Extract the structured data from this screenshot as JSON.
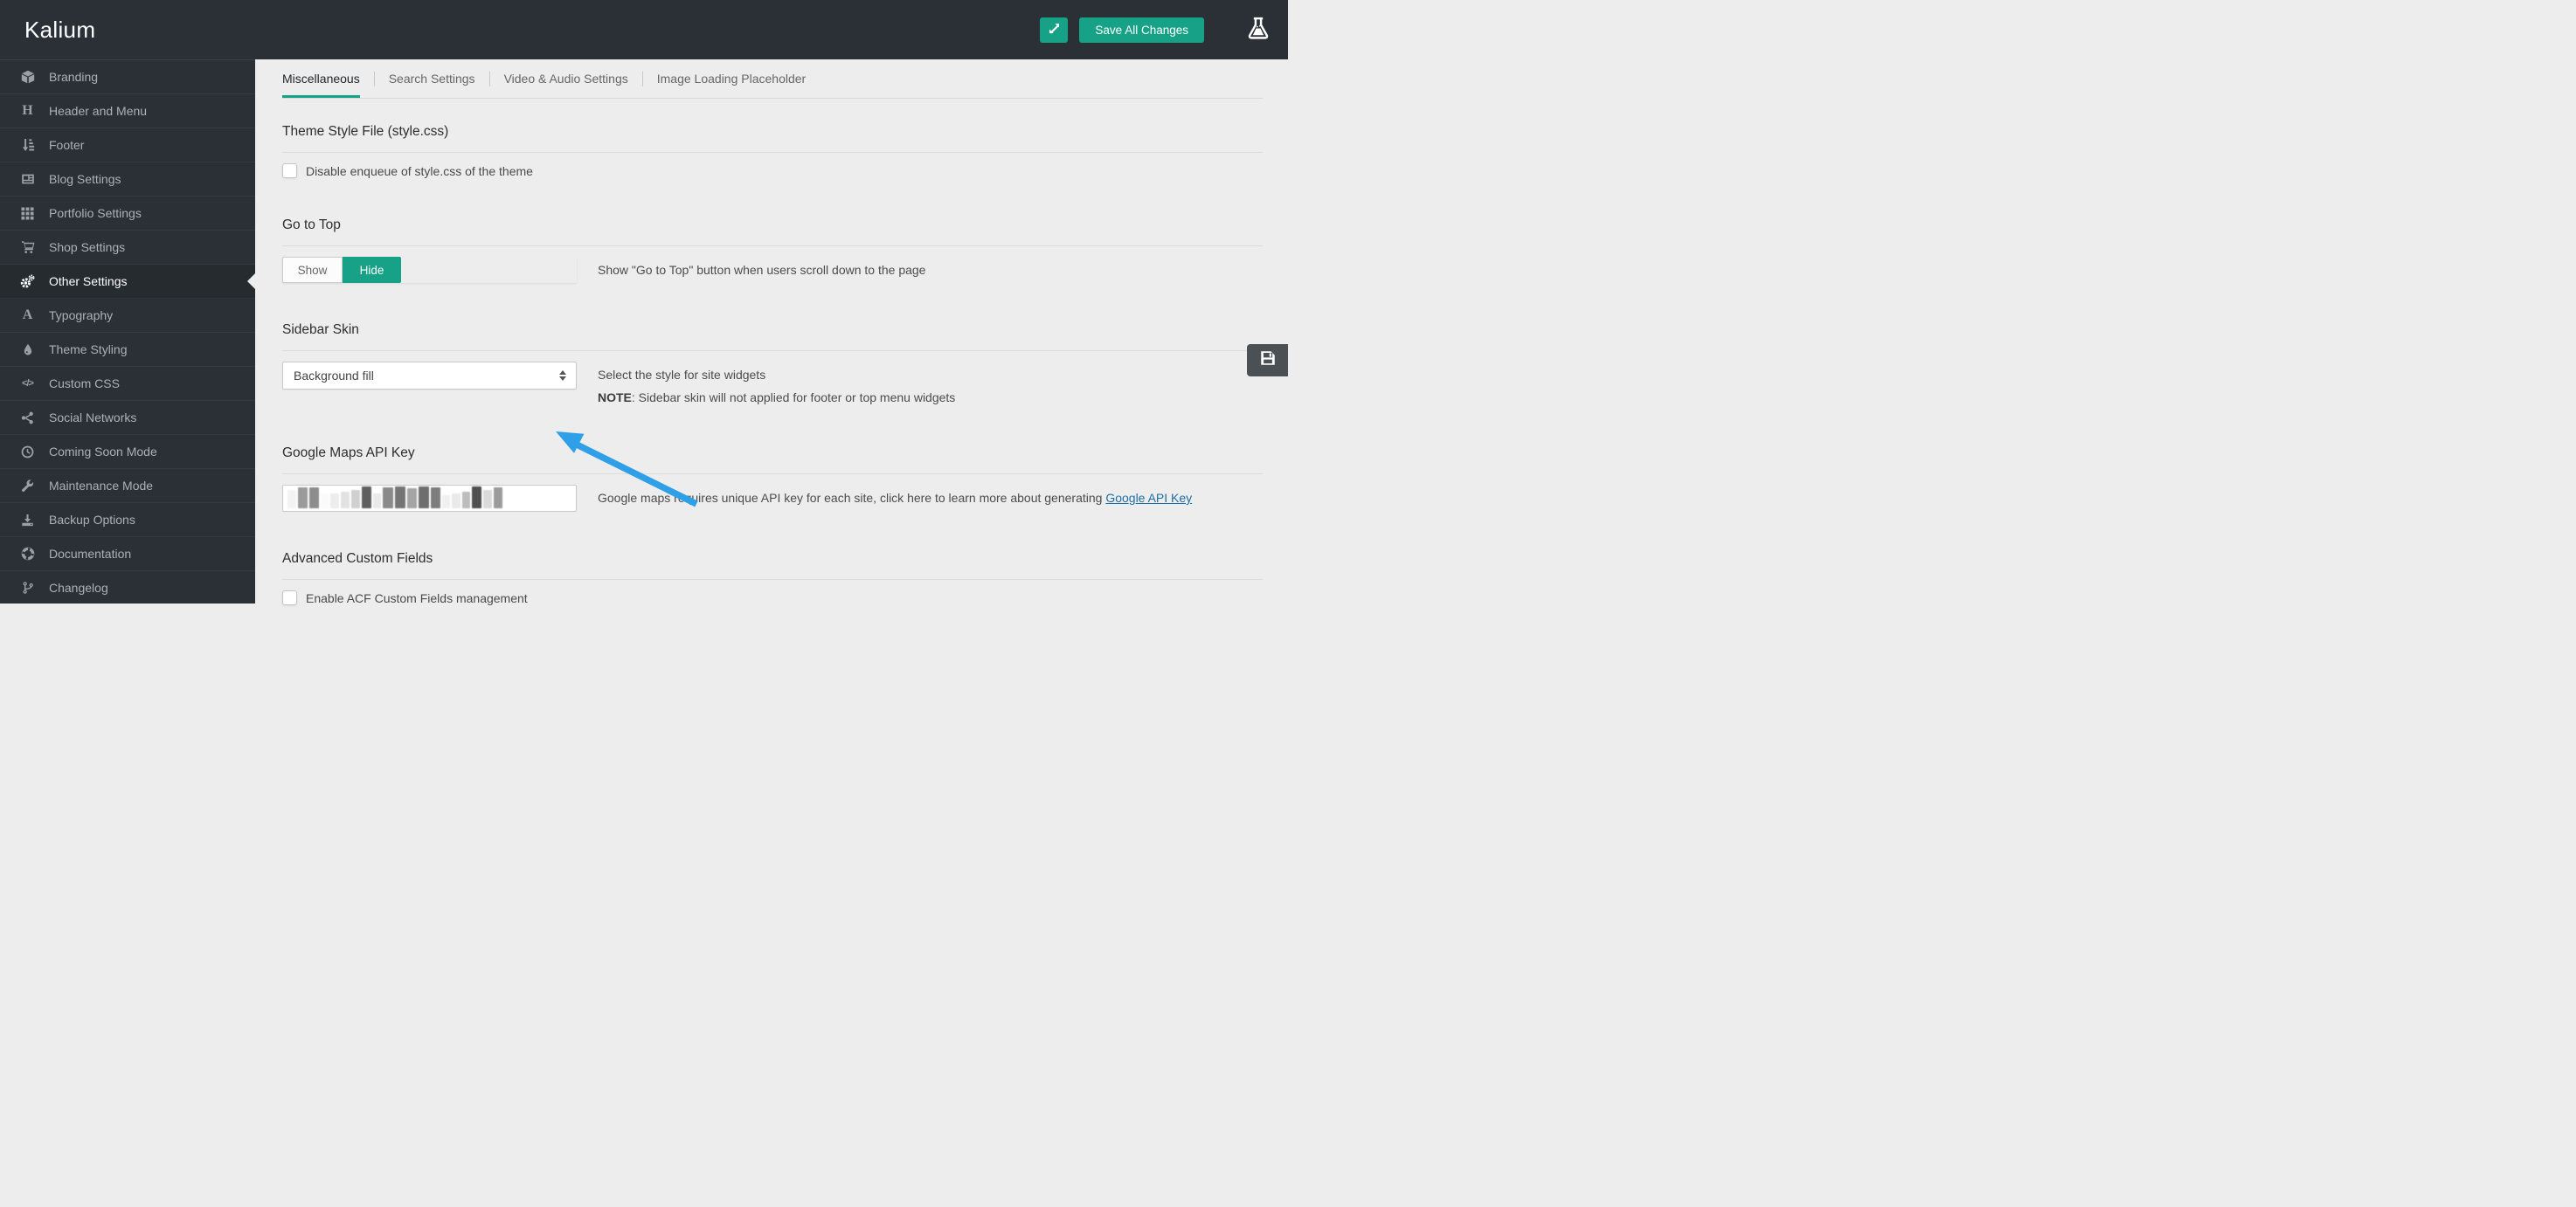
{
  "header": {
    "app_title": "Kalium",
    "save_all_label": "Save All Changes"
  },
  "sidebar": {
    "items": [
      {
        "label": "Branding",
        "icon": "cube-icon",
        "active": false
      },
      {
        "label": "Header and Menu",
        "icon": "heading-icon",
        "active": false
      },
      {
        "label": "Footer",
        "icon": "sort-amount-icon",
        "active": false
      },
      {
        "label": "Blog Settings",
        "icon": "newspaper-icon",
        "active": false
      },
      {
        "label": "Portfolio Settings",
        "icon": "grid-icon",
        "active": false
      },
      {
        "label": "Shop Settings",
        "icon": "cart-icon",
        "active": false
      },
      {
        "label": "Other Settings",
        "icon": "gears-icon",
        "active": true
      },
      {
        "label": "Typography",
        "icon": "typography-icon",
        "active": false
      },
      {
        "label": "Theme Styling",
        "icon": "droplet-icon",
        "active": false
      },
      {
        "label": "Custom CSS",
        "icon": "code-icon",
        "active": false
      },
      {
        "label": "Social Networks",
        "icon": "share-icon",
        "active": false
      },
      {
        "label": "Coming Soon Mode",
        "icon": "clock-icon",
        "active": false
      },
      {
        "label": "Maintenance Mode",
        "icon": "wrench-icon",
        "active": false
      },
      {
        "label": "Backup Options",
        "icon": "download-icon",
        "active": false
      },
      {
        "label": "Documentation",
        "icon": "lifering-icon",
        "active": false
      },
      {
        "label": "Changelog",
        "icon": "branch-icon",
        "active": false
      }
    ]
  },
  "tabs": [
    {
      "label": "Miscellaneous",
      "active": true
    },
    {
      "label": "Search Settings",
      "active": false
    },
    {
      "label": "Video & Audio Settings",
      "active": false
    },
    {
      "label": "Image Loading Placeholder",
      "active": false
    }
  ],
  "sections": {
    "theme_style": {
      "heading": "Theme Style File (style.css)",
      "checkbox_label": "Disable enqueue of style.css of the theme",
      "checked": false
    },
    "go_to_top": {
      "heading": "Go to Top",
      "options": [
        "Show",
        "Hide"
      ],
      "selected": "Hide",
      "description": "Show \"Go to Top\" button when users scroll down to the page"
    },
    "sidebar_skin": {
      "heading": "Sidebar Skin",
      "select_value": "Background fill",
      "description": "Select the style for site widgets",
      "note_label": "NOTE",
      "note_text": ": Sidebar skin will not applied for footer or top menu widgets"
    },
    "google_maps": {
      "heading": "Google Maps API Key",
      "value_redacted": true,
      "masked_blocks": [
        {
          "c": "#f3f3f3",
          "w": 10,
          "h": 21
        },
        {
          "c": "#9a9a9a",
          "w": 11,
          "h": 24
        },
        {
          "c": "#8d8d8d",
          "w": 11,
          "h": 24
        },
        {
          "c": "#fafafa",
          "w": 9,
          "h": 17
        },
        {
          "c": "#ededed",
          "w": 10,
          "h": 17
        },
        {
          "c": "#e2e2e2",
          "w": 10,
          "h": 19
        },
        {
          "c": "#d0d0d0",
          "w": 10,
          "h": 21
        },
        {
          "c": "#5f5f5f",
          "w": 11,
          "h": 25
        },
        {
          "c": "#e9e9e9",
          "w": 9,
          "h": 17
        },
        {
          "c": "#8a8a8a",
          "w": 12,
          "h": 24
        },
        {
          "c": "#757575",
          "w": 12,
          "h": 25
        },
        {
          "c": "#a5a5a5",
          "w": 11,
          "h": 23
        },
        {
          "c": "#6e6e6e",
          "w": 12,
          "h": 25
        },
        {
          "c": "#7d7d7d",
          "w": 11,
          "h": 24
        },
        {
          "c": "#f0f0f0",
          "w": 9,
          "h": 15
        },
        {
          "c": "#eaeaea",
          "w": 10,
          "h": 17
        },
        {
          "c": "#bdbdbd",
          "w": 9,
          "h": 19
        },
        {
          "c": "#4f4f4f",
          "w": 11,
          "h": 25
        },
        {
          "c": "#dadada",
          "w": 10,
          "h": 21
        },
        {
          "c": "#9b9b9b",
          "w": 10,
          "h": 24
        }
      ],
      "description_before_link": "Google maps requires unique API key for each site, click here to learn more about generating ",
      "link_text": "Google API Key"
    },
    "acf": {
      "heading": "Advanced Custom Fields",
      "checkbox_label": "Enable ACF Custom Fields management",
      "checked": false
    }
  },
  "colors": {
    "accent_teal": "#17a287",
    "link_blue": "#1d6fa5",
    "arrow_blue": "#2f9fe8",
    "header_dark": "#2b3036",
    "content_bg": "#ededed"
  }
}
